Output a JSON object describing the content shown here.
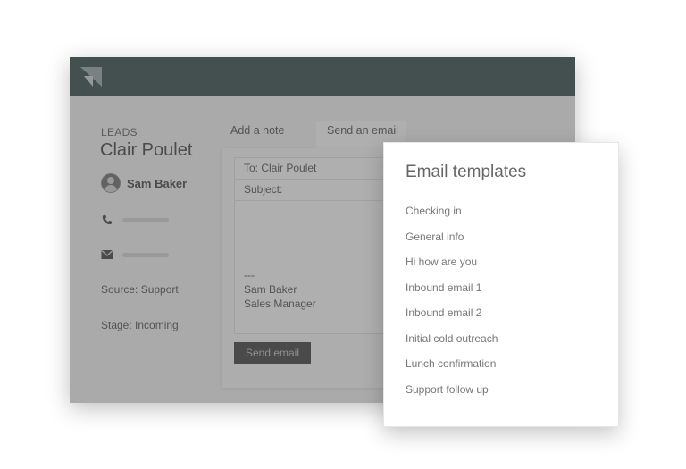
{
  "leads": {
    "section_label": "LEADS",
    "lead_name": "Clair Poulet",
    "owner_name": "Sam Baker",
    "phone_icon": "phone-icon",
    "email_icon": "envelope-icon",
    "source": "Source: Support",
    "stage": "Stage: Incoming"
  },
  "tabs": {
    "note_label": "Add a note",
    "email_label": "Send an email"
  },
  "compose": {
    "to": "To: Clair Poulet",
    "subject": "Subject:",
    "signature_sep": "---",
    "signature_name": "Sam Baker",
    "signature_title": "Sales Manager",
    "send_label": "Send email"
  },
  "templates": {
    "title": "Email templates",
    "items": [
      "Checking in",
      "General info",
      "Hi how are you",
      "Inbound email 1",
      "Inbound email 2",
      "Initial cold outreach",
      "Lunch confirmation",
      "Support follow up"
    ]
  },
  "colors": {
    "topbar": "#122a2b",
    "overlay": "#6e6e6e",
    "send_button": "#1f1f1f"
  }
}
